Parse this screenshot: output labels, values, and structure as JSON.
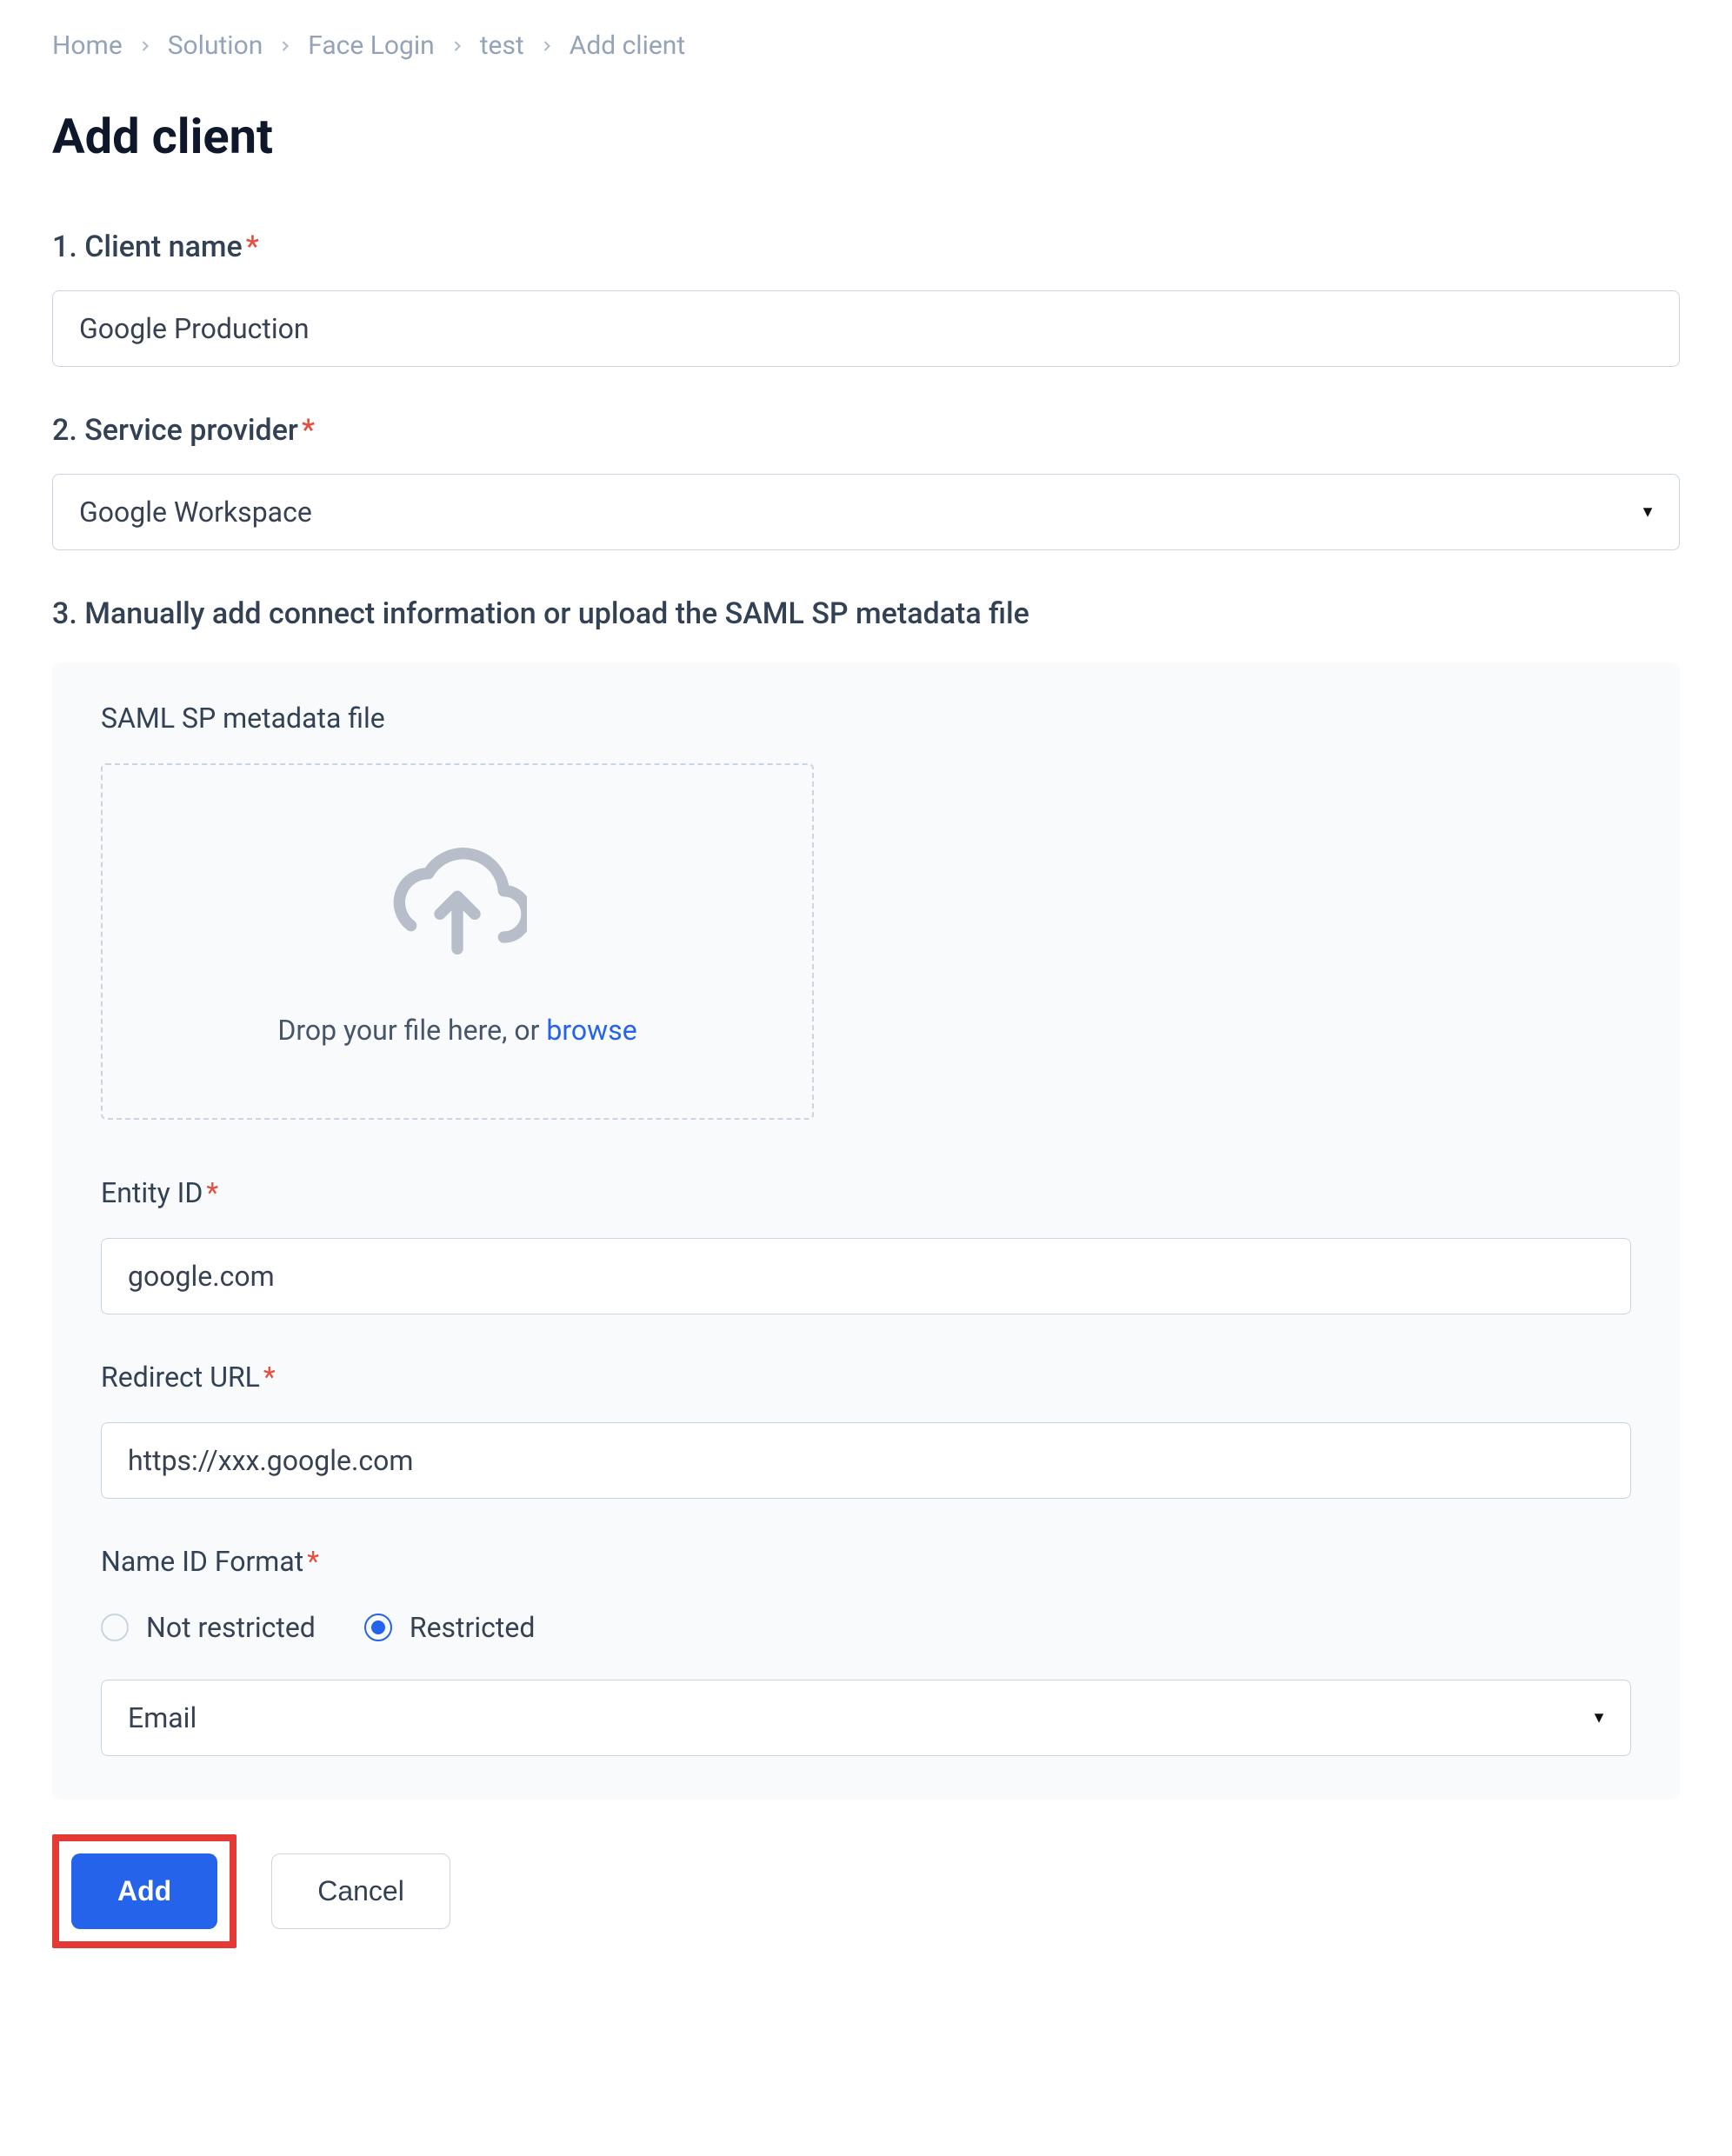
{
  "breadcrumb": {
    "items": [
      "Home",
      "Solution",
      "Face Login",
      "test",
      "Add client"
    ]
  },
  "page_title": "Add client",
  "form": {
    "client_name": {
      "label": "1. Client name",
      "value": "Google Production"
    },
    "service_provider": {
      "label": "2. Service provider",
      "value": "Google Workspace"
    },
    "section3": {
      "label": "3. Manually add connect information or upload the SAML SP metadata file",
      "metadata_file_label": "SAML SP metadata file",
      "dropzone_text": "Drop your file here, or ",
      "dropzone_link": "browse",
      "entity_id": {
        "label": "Entity ID",
        "value": "google.com"
      },
      "redirect_url": {
        "label": "Redirect URL",
        "value": "https://xxx.google.com"
      },
      "name_id_format": {
        "label": "Name ID Format",
        "options": {
          "not_restricted": "Not restricted",
          "restricted": "Restricted"
        },
        "selected": "restricted",
        "select_value": "Email"
      }
    }
  },
  "buttons": {
    "add": "Add",
    "cancel": "Cancel"
  }
}
